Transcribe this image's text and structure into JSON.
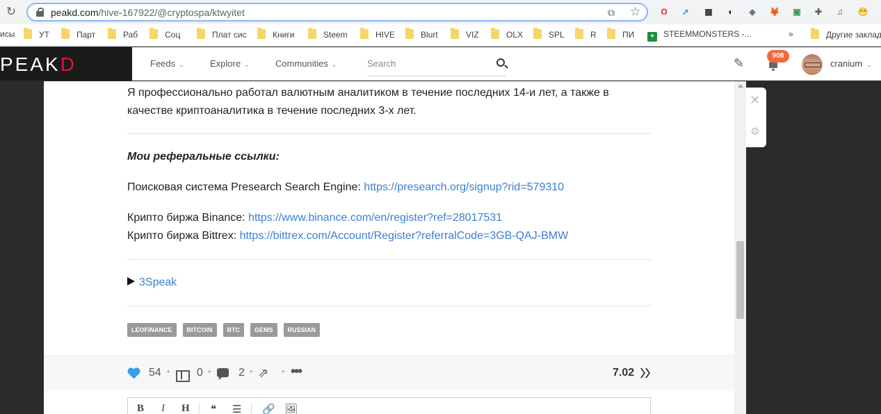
{
  "browser": {
    "url_host": "peakd.com",
    "url_path": "/hive-167922/@cryptospa/ktwyitet",
    "extensions": [
      {
        "name": "opera-ext-icon",
        "color": "#e0252b",
        "glyph": "O"
      },
      {
        "name": "peakd-ext-icon",
        "color": "#2f96d6",
        "glyph": "➚"
      },
      {
        "name": "qr-ext-icon",
        "color": "#333333",
        "glyph": "▦"
      },
      {
        "name": "hive-keychain-icon",
        "color": "#111111",
        "glyph": "◐"
      },
      {
        "name": "shield-ext-icon",
        "color": "#5f6b8a",
        "glyph": "◈"
      },
      {
        "name": "metamask-icon",
        "color": "#e8831d",
        "glyph": "🦊"
      },
      {
        "name": "green-ext-icon",
        "color": "#2e9d47",
        "glyph": "▣"
      },
      {
        "name": "puzzle-icon",
        "color": "#5f6368",
        "glyph": "✚"
      },
      {
        "name": "media-icon",
        "color": "#5f6368",
        "glyph": "♫"
      },
      {
        "name": "profile-emoji-icon",
        "color": "#f2c230",
        "glyph": "😁"
      }
    ],
    "bookmarks": [
      {
        "label": "исы",
        "folder": false
      },
      {
        "label": "УТ",
        "folder": true
      },
      {
        "label": "Парт",
        "folder": true
      },
      {
        "label": "Раб",
        "folder": true
      },
      {
        "label": "Соц",
        "folder": true
      },
      {
        "label": "Плат сис",
        "folder": true
      },
      {
        "label": "Книги",
        "folder": true
      },
      {
        "label": "Steem",
        "folder": true
      },
      {
        "label": "HIVE",
        "folder": true
      },
      {
        "label": "Blurt",
        "folder": true
      },
      {
        "label": "VIZ",
        "folder": true
      },
      {
        "label": "OLX",
        "folder": true
      },
      {
        "label": "SPL",
        "folder": true
      },
      {
        "label": "R",
        "folder": true
      },
      {
        "label": "ПИ",
        "folder": true
      },
      {
        "label": "STEEMMONSTERS -...",
        "folder": false,
        "sheet": true
      },
      {
        "label": "»",
        "folder": false
      },
      {
        "label": "Другие заклад",
        "folder": true
      }
    ]
  },
  "header": {
    "logo_main": "PEAK",
    "logo_d": "D",
    "nav": [
      "Feeds",
      "Explore",
      "Communities"
    ],
    "search_placeholder": "Search",
    "notifications": "908",
    "username": "cranium"
  },
  "post": {
    "intro": "Я профессионально работал валютным аналитиком в течение последних 14-и лет, а также в качестве криптоаналитика в течение последних 3-х лет.",
    "ref_heading": "Мои реферальные ссылки:",
    "presearch_label": "Поисковая система Presearch Search Engine: ",
    "presearch_url": "https://presearch.org/signup?rid=579310",
    "binance_label": "Крипто биржа Binance: ",
    "binance_url": "https://www.binance.com/en/register?ref=28017531",
    "bittrex_label": "Крипто биржа Bittrex: ",
    "bittrex_url": "https://bittrex.com/Account/Register?referralCode=3GB-QAJ-BMW",
    "threespeak": "3Speak",
    "tags": [
      "LEOFINANCE",
      "BITCOIN",
      "BTC",
      "GEMS",
      "RUSSIAN"
    ]
  },
  "actions": {
    "votes": "54",
    "gifts": "0",
    "comments": "2",
    "payout": "7.02"
  },
  "editor_tools": [
    "B",
    "I",
    "H",
    "❝",
    "☰",
    "🔗",
    "🖼"
  ]
}
